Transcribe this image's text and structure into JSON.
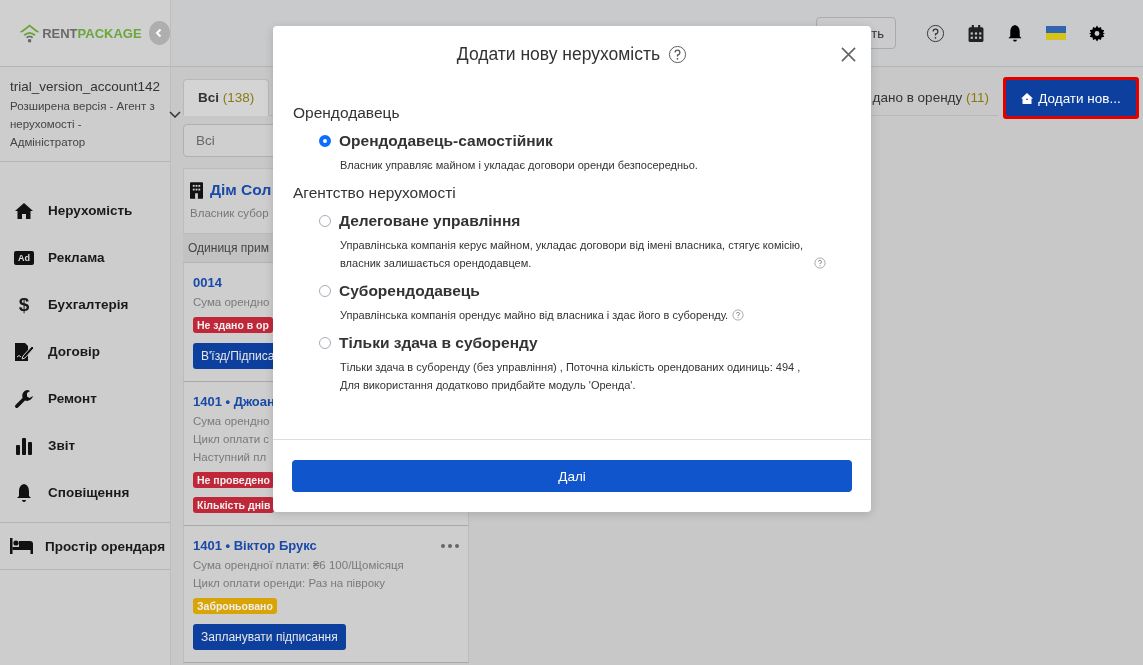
{
  "sidebar": {
    "logo": {
      "part_1": "RENT",
      "part_2": "PACKAGE"
    },
    "account": {
      "name": "trial_version_account142",
      "role": "Розширена версія - Агент з нерухомості - Адміністратор"
    },
    "nav": [
      {
        "label": "Нерухомість"
      },
      {
        "label": "Реклама",
        "icon_text": "Ad"
      },
      {
        "label": "Бухгалтерія",
        "icon_text": "$"
      },
      {
        "label": "Договір"
      },
      {
        "label": "Ремонт"
      },
      {
        "label": "Звіт"
      },
      {
        "label": "Сповіщення"
      }
    ],
    "tenant_space": {
      "label": "Простір орендаря"
    }
  },
  "header": {
    "button_label": "ть"
  },
  "tabs": [
    {
      "label": "Всі",
      "count": "(138)",
      "selected": true
    },
    {
      "label": "дано в оренду",
      "count": "(11)",
      "selected": false
    }
  ],
  "add_button": {
    "label": "Додати нов...",
    "highlighted": true
  },
  "filter": {
    "value": "Всі"
  },
  "property": {
    "title": "Дім Сол",
    "subtitle": "Власник субор",
    "units_header": "Одиниця прим"
  },
  "units": [
    {
      "title": "0014",
      "menu": false,
      "lines": [
        "Сума орендно"
      ],
      "badges": [
        {
          "text": "Не здано в ор",
          "color": "#c0283a"
        }
      ],
      "button": "В'їзд/Підписа"
    },
    {
      "title": "1401 • Джоан",
      "menu": false,
      "lines": [
        "Сума орендно",
        "Цикл оплати с",
        "Наступний пл"
      ],
      "badges": [
        {
          "text": "Не проведено",
          "color": "#c0283a"
        },
        {
          "text": "Кількість днів",
          "color": "#c0283a"
        }
      ]
    },
    {
      "title": "1401 • Віктор Брукс",
      "menu": true,
      "lines": [
        "Сума орендної плати: ₴6 100/Щомісяця",
        "Цикл оплати оренди: Раз на півроку"
      ],
      "badges": [
        {
          "text": "Заброньовано",
          "color": "#d9a406"
        }
      ],
      "button": "Запланувати підписання"
    }
  ],
  "modal": {
    "title": "Додати нову нерухомість",
    "sections": [
      {
        "heading": "Орендодавець",
        "options": [
          {
            "label": "Орендодавець-самостійник",
            "description": "Власник управляє майном і укладає договори оренди безпосередньо.",
            "help": false,
            "selected": true
          }
        ]
      },
      {
        "heading": "Агентство нерухомості",
        "options": [
          {
            "label": "Делеговане управління",
            "description": "Управлінська компанія керує майном, укладає договори від імені власника, стягує комісію, власник залишається орендодавцем.",
            "help": true,
            "selected": false
          },
          {
            "label": "Суборендодавець",
            "description": "Управлінська компанія орендує майно від власника і здає його в суборенду.",
            "help": true,
            "selected": false
          },
          {
            "label": "Тільки здача в суборенду",
            "description": "Тільки здача в суборенду (без управління) , Поточна кількість орендованих одиниць: 494 , Для використання додатково придбайте модуль 'Оренда'.",
            "help": false,
            "selected": false
          }
        ]
      }
    ],
    "next_button": "Далі"
  }
}
